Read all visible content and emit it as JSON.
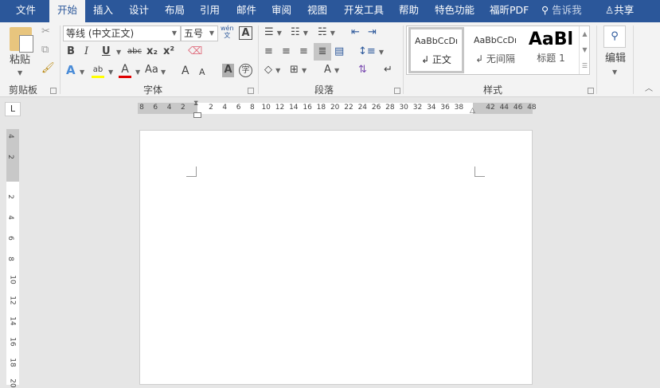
{
  "tabs": [
    "文件",
    "开始",
    "插入",
    "设计",
    "布局",
    "引用",
    "邮件",
    "审阅",
    "视图",
    "开发工具",
    "帮助",
    "特色功能",
    "福昕PDF"
  ],
  "search_label": "告诉我",
  "share_label": "共享",
  "clipboard": {
    "paste": "粘贴",
    "group": "剪贴板"
  },
  "font": {
    "name": "等线 (中文正文)",
    "size": "五号",
    "group": "字体",
    "phonetic_top": "wén",
    "phonetic_bottom": "文",
    "bold": "B",
    "italic": "I",
    "underline": "U",
    "strike": "abc",
    "sub": "x₂",
    "sup": "x²",
    "change_case": "Aa",
    "grow": "A",
    "shrink": "A",
    "shade": "A",
    "enclose": "字"
  },
  "paragraph": {
    "group": "段落"
  },
  "styles": {
    "group": "样式",
    "items": [
      {
        "preview": "AaBbCcDı",
        "name": "↲ 正文"
      },
      {
        "preview": "AaBbCcDı",
        "name": "↲ 无间隔"
      },
      {
        "preview": "AaBl",
        "name": "标题 1"
      }
    ]
  },
  "editing": {
    "label": "编辑"
  },
  "ruler": {
    "left": [
      "8",
      "6",
      "4",
      "2"
    ],
    "main": [
      "2",
      "4",
      "6",
      "8",
      "10",
      "12",
      "14",
      "16",
      "18",
      "20",
      "22",
      "24",
      "26",
      "28",
      "30",
      "32",
      "34",
      "36",
      "38"
    ],
    "right": [
      "42",
      "44",
      "46",
      "48"
    ],
    "vtop": [
      "4",
      "2"
    ],
    "vmain": [
      "2",
      "4",
      "6",
      "8",
      "10",
      "12",
      "14",
      "16",
      "18",
      "20"
    ],
    "tab_selector": "L"
  },
  "colors": {
    "accent": "#2b579a",
    "highlight": "#ffff00",
    "font_color": "#e00000"
  }
}
